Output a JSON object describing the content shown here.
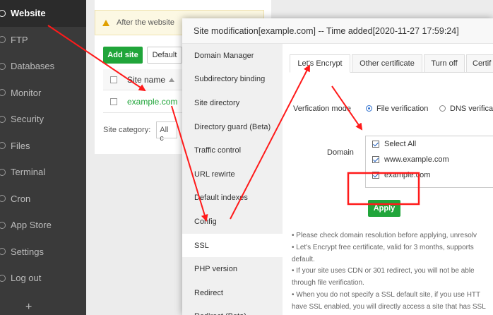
{
  "nav": {
    "items": [
      {
        "label": "Website",
        "icon": "globe-icon",
        "active": true
      },
      {
        "label": "FTP",
        "icon": "ftp-icon"
      },
      {
        "label": "Databases",
        "icon": "database-icon"
      },
      {
        "label": "Monitor",
        "icon": "monitor-icon"
      },
      {
        "label": "Security",
        "icon": "shield-icon"
      },
      {
        "label": "Files",
        "icon": "folder-icon"
      },
      {
        "label": "Terminal",
        "icon": "terminal-icon"
      },
      {
        "label": "Cron",
        "icon": "clock-icon"
      },
      {
        "label": "App Store",
        "icon": "app-store-icon"
      },
      {
        "label": "Settings",
        "icon": "gear-icon"
      },
      {
        "label": "Log out",
        "icon": "logout-icon"
      }
    ],
    "add_label": "+"
  },
  "background_page": {
    "alert_text": "After the website",
    "add_site_label": "Add site",
    "default_label": "Default",
    "table_header": "Site name",
    "row_site": "example.com",
    "category_label": "Site category:",
    "category_value": "All c"
  },
  "modal": {
    "title": "Site modification[example.com] -- Time added[2020-11-27 17:59:24]",
    "side_items": [
      "Domain Manager",
      "Subdirectory binding",
      "Site directory",
      "Directory guard (Beta)",
      "Traffic control",
      "URL rewirte",
      "Default indexes",
      "Config",
      "SSL",
      "PHP version",
      "Redirect",
      "Redirect (Beta)"
    ],
    "active_side_item": "SSL",
    "tabs": [
      "Let's Encrypt",
      "Other certificate",
      "Turn off",
      "Certif"
    ],
    "verification_label": "Verfication mode",
    "verification_options": [
      "File verification",
      "DNS verificat"
    ],
    "domain_label": "Domain",
    "domains": [
      "Select All",
      "www.example.com",
      "example.com"
    ],
    "apply_label": "Apply",
    "notes": [
      "• Please check domain resolution before applying, unresolv",
      "• Let's Encrypt free certificate, valid for 3 months, supports",
      "default.",
      "• If your site uses CDN or 301 redirect, you will not be able",
      "through file verification.",
      "• When you do not specify a SSL default site, if you use HTT",
      "have SSL enabled, you will directly access a site that has SSL"
    ]
  },
  "colors": {
    "accent_green": "#20a53a",
    "annotation_red": "#ff1a1a",
    "nav_bg": "#3a3a3a"
  }
}
